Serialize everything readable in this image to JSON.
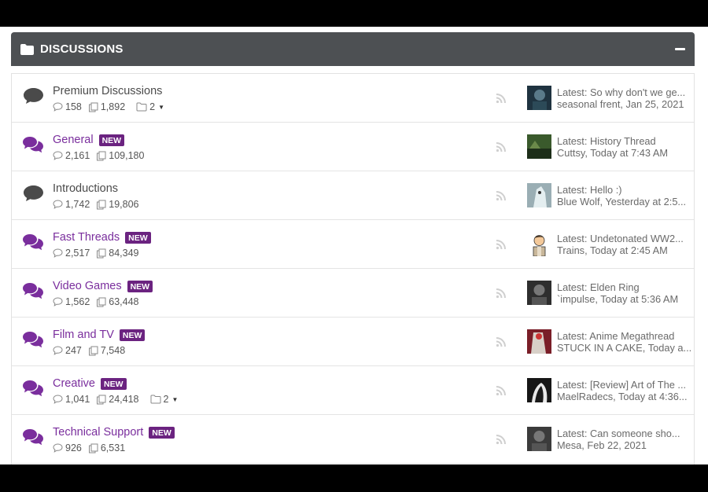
{
  "header": {
    "title": "DISCUSSIONS"
  },
  "latest_prefix": "Latest: ",
  "forums": [
    {
      "name": "Premium Discussions",
      "unread": false,
      "badge": "",
      "threads": "158",
      "messages": "1,892",
      "subforums": "2",
      "latest_title": "So why don't we ge...",
      "latest_user": "seasonal frent,",
      "latest_time": " Jan 25, 2021",
      "avatar_color": "#1f3340"
    },
    {
      "name": "General",
      "unread": true,
      "badge": "NEW",
      "threads": "2,161",
      "messages": "109,180",
      "subforums": "",
      "latest_title": "History Thread",
      "latest_user": "Cuttsy,",
      "latest_time": " Today at 7:43 AM",
      "avatar_color": "#3a5a2c"
    },
    {
      "name": "Introductions",
      "unread": false,
      "badge": "",
      "threads": "1,742",
      "messages": "19,806",
      "subforums": "",
      "latest_title": "Hello :)",
      "latest_user": "Blue Wolf,",
      "latest_time": " Yesterday at 2:5...",
      "avatar_color": "#8aa0a8"
    },
    {
      "name": "Fast Threads",
      "unread": true,
      "badge": "NEW",
      "threads": "2,517",
      "messages": "84,349",
      "subforums": "",
      "latest_title": "Undetonated WW2...",
      "latest_user": "Trains,",
      "latest_time": " Today at 2:45 AM",
      "avatar_color": "#ffffff"
    },
    {
      "name": "Video Games",
      "unread": true,
      "badge": "NEW",
      "threads": "1,562",
      "messages": "63,448",
      "subforums": "",
      "latest_title": "Elden Ring",
      "latest_user": "`impulse,",
      "latest_time": " Today at 5:36 AM",
      "avatar_color": "#2e2e2e"
    },
    {
      "name": "Film and TV",
      "unread": true,
      "badge": "NEW",
      "threads": "247",
      "messages": "7,548",
      "subforums": "",
      "latest_title": "Anime Megathread",
      "latest_user": "STUCK IN A CAKE,",
      "latest_time": " Today a...",
      "avatar_color": "#a12a35"
    },
    {
      "name": "Creative",
      "unread": true,
      "badge": "NEW",
      "threads": "1,041",
      "messages": "24,418",
      "subforums": "2",
      "latest_title": "[Review] Art of The ...",
      "latest_user": "MaelRadecs,",
      "latest_time": " Today at 4:36...",
      "avatar_color": "#1b1b1b"
    },
    {
      "name": "Technical Support",
      "unread": true,
      "badge": "NEW",
      "threads": "926",
      "messages": "6,531",
      "subforums": "",
      "latest_title": "Can someone sho...",
      "latest_user": "Mesa,",
      "latest_time": " Feb 22, 2021",
      "avatar_color": "#3b3b3b"
    }
  ],
  "colors": {
    "unread_accent": "#7a2e9d",
    "badge_bg": "#6b2380",
    "header_bg": "#4d5053",
    "read_icon": "#4a4a4a"
  },
  "icons": {
    "header": "folder-icon",
    "forum_read": "comment-icon",
    "forum_unread": "comments-icon",
    "threads": "speech-bubble-icon",
    "messages": "copy-icon",
    "subforums": "folder-outline-icon",
    "rss": "rss-icon"
  }
}
